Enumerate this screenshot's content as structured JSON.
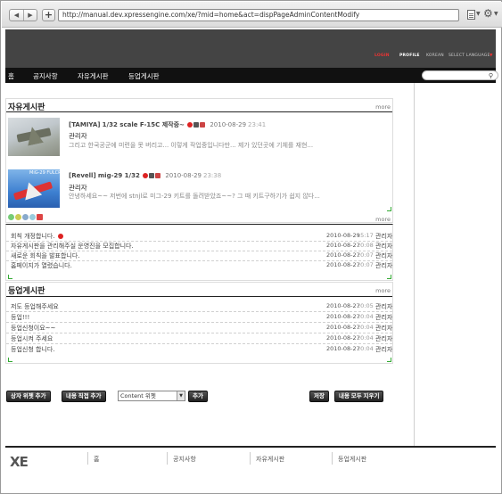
{
  "browser": {
    "url": "http://manual.dev.xpressengine.com/xe/?mid=home&act=dispPageAdminContentModify",
    "back_glyph": "◀",
    "forward_glyph": "▶",
    "add_glyph": "+",
    "icons": [
      "arrow-left-icon",
      "arrow-right-icon",
      "plus-icon",
      "page-icon",
      "gear-icon"
    ]
  },
  "header": {
    "links": {
      "login": "LOGIN",
      "profile": "PROFILE",
      "korean": "KOREAN",
      "select_language": "SELECT LANGUAGE",
      "arrow": "▼"
    }
  },
  "gnb": {
    "items": [
      "홈",
      "공지사항",
      "자유게시판",
      "등업게시판"
    ]
  },
  "widget1": {
    "title": "자유게시판",
    "more": "more",
    "posts": [
      {
        "prefix": "[TAMIYA]",
        "subject": "1/32 scale F-15C 제작중~",
        "date": "2010-08-29",
        "time": "23:41",
        "author": "관리자",
        "excerpt": "그리고 한국공군에 미련을 못 버리고... 이렇게 작업중입니다만... 제가 있던곳에 기체를 재현...",
        "thumb_caption": ""
      },
      {
        "prefix": "[Revell]",
        "subject": "mig-29 1/32",
        "date": "2010-08-29",
        "time": "23:38",
        "author": "관리자",
        "excerpt": "안녕하세요~~ 저번에 stnjl로 미그-29 키트를 돌려받았죠~~? 그 때 키트구하기가 쉽지 않다...",
        "thumb_caption": "MiG-29 FULCRUM"
      }
    ]
  },
  "widget2": {
    "more": "more",
    "rows": [
      {
        "title": "회칙 개정합니다.",
        "new": true,
        "date": "2010-08-29",
        "time": "15:17",
        "author": "관리자"
      },
      {
        "title": "자유게시판을 관리해주실 운영진을 모집합니다.",
        "new": false,
        "date": "2010-08-27",
        "time": "20:08",
        "author": "관리자"
      },
      {
        "title": "새로운 회칙을 발표합니다.",
        "new": false,
        "date": "2010-08-27",
        "time": "20:07",
        "author": "관리자"
      },
      {
        "title": "홈페이지가 열렸습니다.",
        "new": false,
        "date": "2010-08-27",
        "time": "20:07",
        "author": "관리자"
      }
    ]
  },
  "widget3": {
    "title": "등업게시판",
    "more": "more",
    "rows": [
      {
        "title": "저도 등업해주세요",
        "date": "2010-08-27",
        "time": "20:05",
        "author": "관리자"
      },
      {
        "title": "등업!!!",
        "date": "2010-08-27",
        "time": "20:04",
        "author": "관리자"
      },
      {
        "title": "등업신청이요~~",
        "date": "2010-08-27",
        "time": "20:04",
        "author": "관리자"
      },
      {
        "title": "등업시켜 주세요",
        "date": "2010-08-27",
        "time": "20:04",
        "author": "관리자"
      },
      {
        "title": "등업신청 합니다.",
        "date": "2010-08-27",
        "time": "20:04",
        "author": "관리자"
      }
    ]
  },
  "actions": {
    "add_widget": "상자 위젯 추가",
    "add_content": "내용 직접 추가",
    "select_value": "Content 위젯",
    "add": "추가",
    "save": "저장",
    "delete_all": "내용 모두 지우기"
  },
  "footer": {
    "logo": "XE",
    "items": [
      "홈",
      "공지사항",
      "자유게시판",
      "등업게시판"
    ]
  }
}
